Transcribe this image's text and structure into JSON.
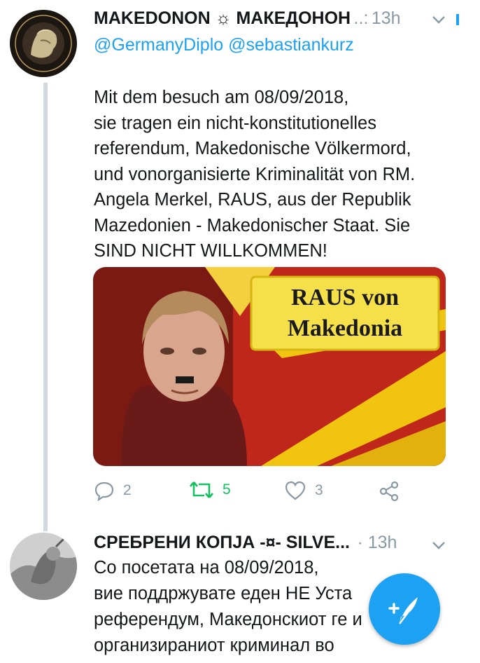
{
  "tweet1": {
    "display_name": "MAKEDONON ☼ МАКЕДОНОН",
    "name_suffix": "..:",
    "time": "13h",
    "mentions": "@GermanyDiplo @sebastiankurz",
    "text": "Mit dem besuch am 08/09/2018,\nsie tragen ein nicht-konstitutionelles\nreferendum, Makedonische Völkermord,\nund vonorganisierte Kriminalität von RM.\nAngela Merkel, RAUS, aus der Republik\nMazedonien - Makedonischer Staat. Sie\nSIND NICHT WILLKOMMEN!",
    "image_caption_line1": "RAUS von",
    "image_caption_line2": "Makedonia",
    "actions": {
      "reply_count": "2",
      "retweet_count": "5",
      "like_count": "3"
    }
  },
  "tweet2": {
    "display_name": "СРЕБРЕНИ КОПЈА -¤- SILVE...",
    "time": "· 13h",
    "text": "Со посетата на 08/09/2018,\nвие поддржувате еден НЕ Уста\nреферендум, Македонскиот ге         и\nорганизираниот криминал во"
  },
  "colors": {
    "accent": "#1da1f2",
    "retweet": "#17bf63",
    "muted": "#8899a6"
  },
  "icons": [
    "reply-icon",
    "retweet-icon",
    "like-icon",
    "share-icon",
    "chevron-down-icon",
    "compose-icon"
  ]
}
